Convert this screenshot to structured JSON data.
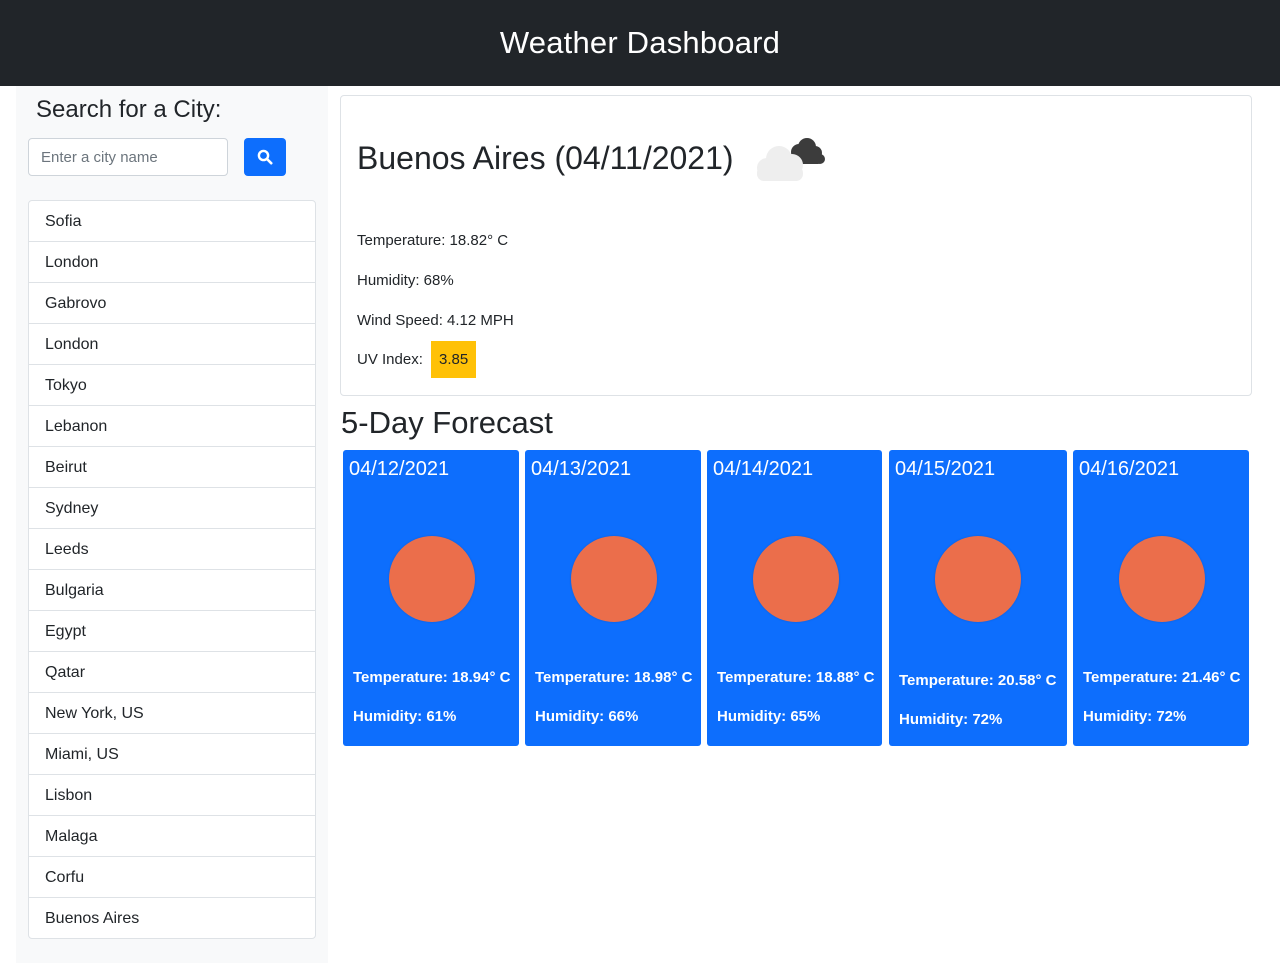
{
  "header": {
    "title": "Weather Dashboard"
  },
  "sidebar": {
    "title": "Search for a City:",
    "search": {
      "placeholder": "Enter a city name",
      "value": ""
    },
    "search_button_icon": "search-icon",
    "cities": [
      "Sofia",
      "London",
      "Gabrovo",
      "London",
      "Tokyo",
      "Lebanon",
      "Beirut",
      "Sydney",
      "Leeds",
      "Bulgaria",
      "Egypt",
      "Qatar",
      "New York, US",
      "Miami, US",
      "Lisbon",
      "Malaga",
      "Corfu",
      "Buenos Aires"
    ]
  },
  "current": {
    "title": "Buenos Aires (04/11/2021)",
    "icon": "cloudy-icon",
    "temperature": "Temperature: 18.82° C",
    "humidity": "Humidity: 68%",
    "wind": "Wind Speed: 4.12 MPH",
    "uv_label": "UV Index:",
    "uv_value": "3.85",
    "uv_color": "#ffc107"
  },
  "forecast": {
    "heading": "5-Day Forecast",
    "days": [
      {
        "date": "04/12/2021",
        "icon": "sun-icon",
        "temperature": "Temperature: 18.94° C",
        "humidity": "Humidity: 61%"
      },
      {
        "date": "04/13/2021",
        "icon": "sun-icon",
        "temperature": "Temperature: 18.98° C",
        "humidity": "Humidity: 66%"
      },
      {
        "date": "04/14/2021",
        "icon": "sun-icon",
        "temperature": "Temperature: 18.88° C",
        "humidity": "Humidity: 65%"
      },
      {
        "date": "04/15/2021",
        "icon": "sun-icon",
        "temperature": "Temperature: 20.58° C",
        "humidity": "Humidity: 72%"
      },
      {
        "date": "04/16/2021",
        "icon": "sun-icon",
        "temperature": "Temperature: 21.46° C",
        "humidity": "Humidity: 72%"
      }
    ]
  },
  "colors": {
    "navbar": "#212529",
    "primary": "#0d6efd",
    "sun": "#eb6e4b",
    "sidebar": "#f8f9fa"
  }
}
